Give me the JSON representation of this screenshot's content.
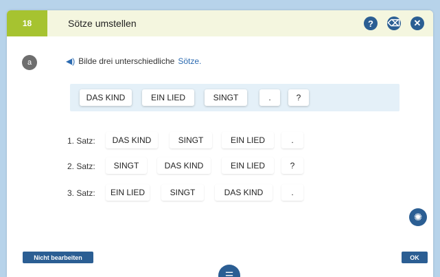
{
  "header": {
    "exercise_number": "18",
    "title": "Sötze umstellen",
    "help_icon": "question-icon",
    "eraser_icon": "eraser-icon",
    "close_icon": "close-icon",
    "help_glyph": "?",
    "eraser_glyph": "⌫",
    "close_glyph": "✕"
  },
  "task": {
    "label": "a",
    "speaker_icon": "speaker-icon",
    "speaker_glyph": "◀)",
    "instruction_prefix": "Bilde drei unterschiedliche",
    "instruction_link": "Sötze."
  },
  "pool": {
    "tiles": [
      "DAS KIND",
      "EIN LIED",
      "SINGT",
      ".",
      "?"
    ]
  },
  "rows": [
    {
      "label": "1. Satz:",
      "tiles": [
        "DAS KIND",
        "SINGT",
        "EIN LIED",
        "."
      ]
    },
    {
      "label": "2. Satz:",
      "tiles": [
        "SINGT",
        "DAS KIND",
        "EIN LIED",
        "?"
      ]
    },
    {
      "label": "3. Satz:",
      "tiles": [
        "EIN LIED",
        "SINGT",
        "DAS KIND",
        "."
      ]
    }
  ],
  "footer": {
    "skip_label": "Nicht bearbeiten",
    "ok_label": "OK",
    "hint_icon": "lightbulb-icon",
    "hint_glyph": "✺",
    "menu_icon": "menu-icon",
    "menu_glyph": "☰"
  },
  "colors": {
    "accent_green": "#a6c330",
    "primary_blue": "#2b5e93",
    "pool_background": "#e4f0f8",
    "page_background": "#b7d3ea"
  }
}
